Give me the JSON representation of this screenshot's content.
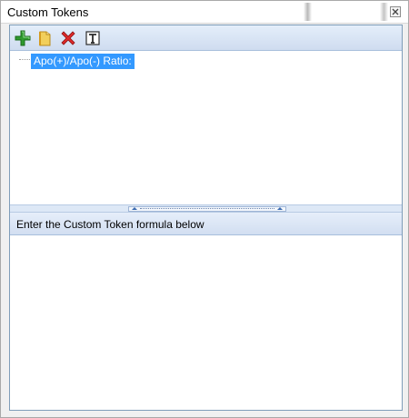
{
  "window": {
    "title": "Custom Tokens",
    "close_icon": "close-icon"
  },
  "toolbar": {
    "buttons": [
      {
        "name": "add-token-button",
        "icon": "plus-icon"
      },
      {
        "name": "folder-button",
        "icon": "folder-icon"
      },
      {
        "name": "delete-button",
        "icon": "delete-x-icon"
      },
      {
        "name": "rename-button",
        "icon": "text-tool-icon"
      }
    ]
  },
  "tree": {
    "items": [
      {
        "label": "Apo(+)/Apo(-) Ratio:",
        "selected": true
      }
    ]
  },
  "formula": {
    "header": "Enter the Custom Token formula below",
    "value": ""
  },
  "colors": {
    "selection": "#3399ff",
    "panel_header": "#d2def1",
    "border": "#7f9db9"
  }
}
